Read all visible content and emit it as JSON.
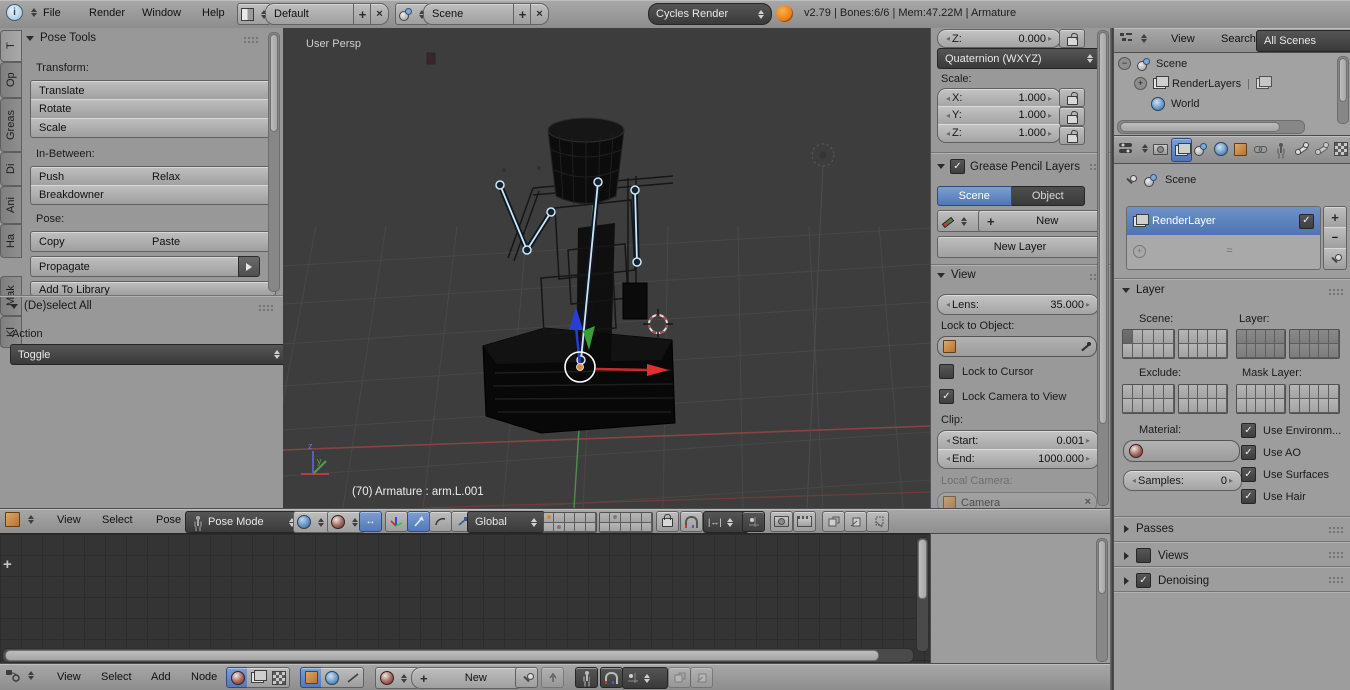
{
  "topbar": {
    "menus": [
      "File",
      "Render",
      "Window",
      "Help"
    ],
    "layout": "Default",
    "scene": "Scene",
    "engine": "Cycles Render",
    "status": "v2.79 | Bones:6/6  | Mem:47.22M | Armature"
  },
  "toolshelf": {
    "tabs": [
      "T",
      "Op",
      "Greas",
      "Di",
      "Ani",
      "Ha",
      "Mak",
      "Kl"
    ],
    "pose_tools": {
      "title": "Pose Tools",
      "transform_label": "Transform:",
      "translate": "Translate",
      "rotate": "Rotate",
      "scale": "Scale",
      "inbetween_label": "In-Between:",
      "push": "Push",
      "relax": "Relax",
      "breakdowner": "Breakdowner",
      "pose_label": "Pose:",
      "copy": "Copy",
      "paste": "Paste",
      "propagate": "Propagate",
      "add_to_library": "Add To Library"
    },
    "deselect": {
      "title": "(De)select All",
      "action_label": "Action",
      "action": "Toggle"
    }
  },
  "viewport": {
    "label": "User Persp",
    "status": "(70) Armature : arm.L.001",
    "header": {
      "view": "View",
      "select": "Select",
      "pose": "Pose",
      "mode": "Pose Mode",
      "orientation": "Global"
    },
    "axis_x": "x",
    "axis_y": "y",
    "axis_z": "z"
  },
  "npanel": {
    "z_label": "Z:",
    "z_value": "0.000",
    "rotation_mode": "Quaternion (WXYZ)",
    "scale_label": "Scale:",
    "x_label": "X:",
    "x_value": "1.000",
    "y_label": "Y:",
    "y_value": "1.000",
    "sz_label": "Z:",
    "sz_value": "1.000",
    "gp_title": "Grease Pencil Layers",
    "gp_scene": "Scene",
    "gp_object": "Object",
    "gp_new": "New",
    "gp_new_layer": "New Layer",
    "view_title": "View",
    "lens_label": "Lens:",
    "lens_value": "35.000",
    "lock_obj_label": "Lock to Object:",
    "lock_cursor": "Lock to Cursor",
    "lock_camera": "Lock Camera to View",
    "clip_label": "Clip:",
    "start_label": "Start:",
    "start_value": "0.001",
    "end_label": "End:",
    "end_value": "1000.000",
    "local_camera_label": "Local Camera:",
    "camera": "Camera"
  },
  "outliner": {
    "view": "View",
    "search": "Search",
    "filter": "All Scenes",
    "scene": "Scene",
    "renderlayers": "RenderLayers",
    "world": "World"
  },
  "props": {
    "breadcrumb": "Scene",
    "renderlayer": "RenderLayer",
    "layer_title": "Layer",
    "scene_label": "Scene:",
    "layer_label": "Layer:",
    "exclude_label": "Exclude:",
    "mask_label": "Mask Layer:",
    "material_label": "Material:",
    "samples_label": "Samples:",
    "samples_value": "0",
    "use_env": "Use Environm...",
    "use_ao": "Use AO",
    "use_surfaces": "Use Surfaces",
    "use_hair": "Use Hair",
    "passes": "Passes",
    "views": "Views",
    "denoising": "Denoising"
  },
  "node": {
    "view": "View",
    "select": "Select",
    "add": "Add",
    "node": "Node",
    "new_label": "New"
  }
}
